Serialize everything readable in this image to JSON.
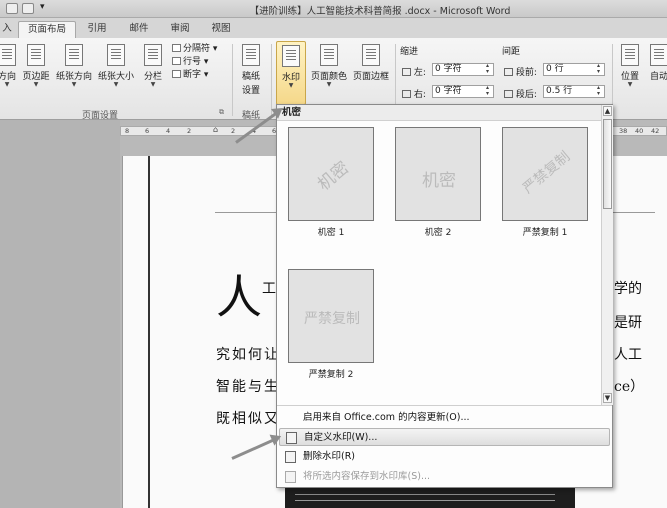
{
  "window": {
    "title": "【进阶训练】人工智能技术科普简报 .docx - Microsoft Word"
  },
  "tabs": [
    {
      "label": "入"
    },
    {
      "label": "页面布局",
      "active": true
    },
    {
      "label": "引用"
    },
    {
      "label": "邮件"
    },
    {
      "label": "审阅"
    },
    {
      "label": "视图"
    }
  ],
  "ribbon": {
    "page_setup": {
      "buttons": {
        "orientation": "方向",
        "margins": "页边距",
        "orientation2": "纸张方向",
        "size": "纸张大小",
        "columns": "分栏"
      },
      "breaks": "分隔符",
      "line_numbers": "行号",
      "hyphenation": "断字",
      "group_label": "页面设置"
    },
    "draft": {
      "button_l1": "稿纸",
      "button_l2": "设置",
      "group_label": "稿纸"
    },
    "background": {
      "watermark": "水印",
      "page_color": "页面颜色",
      "page_border": "页面边框"
    },
    "indent": {
      "heading": "缩进",
      "left_label": "左:",
      "left_value": "0 字符",
      "right_label": "右:",
      "right_value": "0 字符"
    },
    "spacing": {
      "heading": "间距",
      "before_label": "段前:",
      "before_value": "0 行",
      "after_label": "段后:",
      "after_value": "0.5 行"
    },
    "arrange": {
      "position": "位置",
      "wrap": "自动"
    }
  },
  "ruler": {
    "ticks": [
      "8",
      "6",
      "4",
      "2",
      "2",
      "4",
      "6",
      "38",
      "40",
      "42"
    ]
  },
  "document": {
    "big_char": "人",
    "big_char2": "工",
    "line1_tail": "学的",
    "line2_tail": "是研",
    "line3": "究如何让",
    "line3_tail": "人工",
    "line4": "智能与生",
    "line4_tail": "ce）",
    "line5": "既相似又"
  },
  "gallery": {
    "header": "机密",
    "items": [
      {
        "caption": "机密 1",
        "watermark": "机密"
      },
      {
        "caption": "机密 2",
        "watermark": "机密"
      },
      {
        "caption": "严禁复制 1",
        "watermark": "严禁复制"
      },
      {
        "caption": "严禁复制 2",
        "watermark": "严禁复制"
      }
    ],
    "menu": {
      "update": "启用来自 Office.com 的内容更新(O)...",
      "custom": "自定义水印(W)...",
      "remove": "删除水印(R)",
      "save": "将所选内容保存到水印库(S)..."
    }
  },
  "colors": {
    "accent_gray": "#8d8d8d"
  }
}
